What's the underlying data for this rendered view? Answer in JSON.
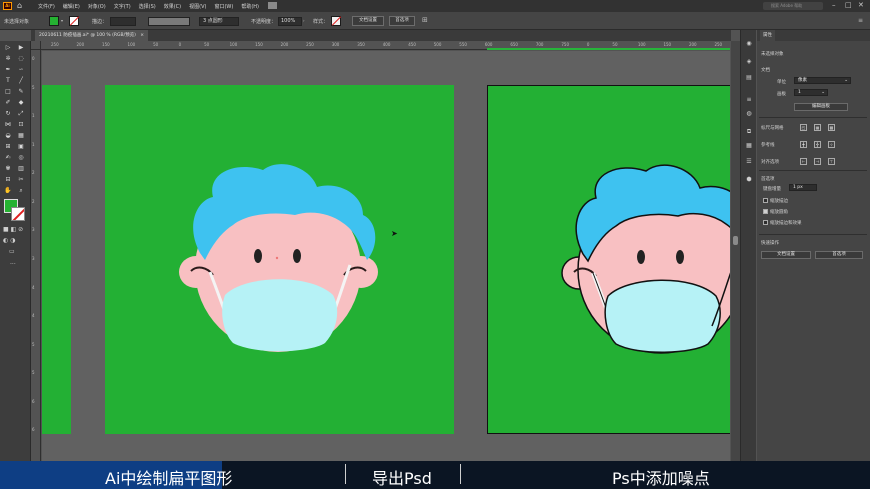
{
  "menubar": {
    "logo": "Ai",
    "menus": [
      "文件(F)",
      "编辑(E)",
      "对象(O)",
      "文字(T)",
      "选择(S)",
      "效果(C)",
      "视图(V)",
      "窗口(W)",
      "帮助(H)"
    ],
    "search_placeholder": "搜索 Adobe 帮助"
  },
  "controlbar": {
    "selection_label": "未选择对象",
    "stroke_label": "描边：",
    "stroke_value": "",
    "brush_label": "3 点圆形",
    "opacity_label": "不透明度：",
    "opacity_value": "100%",
    "style_label": "样式：",
    "doc_setup": "文档设置",
    "preferences": "首选项"
  },
  "document_tab": {
    "title": "20210611 防疫插画.ai* @ 100 % (RGB/预览)"
  },
  "ruler": {
    "top_ticks": [
      "250",
      "200",
      "150",
      "100",
      "50",
      "0",
      "50",
      "100",
      "150",
      "200",
      "250",
      "300",
      "350",
      "400",
      "450",
      "500",
      "550",
      "600",
      "650",
      "700",
      "750",
      "0",
      "50",
      "100",
      "150",
      "200",
      "250"
    ],
    "left_ticks": [
      "0",
      "5",
      "1",
      "1",
      "2",
      "2",
      "3",
      "3",
      "4",
      "4",
      "5",
      "5",
      "6",
      "6"
    ]
  },
  "properties": {
    "tab": "属性",
    "selection": "未选择对象",
    "doc_section": "文档",
    "unit_label": "单位",
    "unit_value": "像素",
    "artboard_label": "画板",
    "artboard_value": "1",
    "edit_artboards": "编辑画板",
    "snap_label": "标尺与网格",
    "guides_label": "参考线",
    "align_label": "对齐选项",
    "prefs_section": "首选项",
    "keyboard_inc_label": "键盘增量",
    "keyboard_inc_value": "1 px",
    "cb_scale_strokes": "缩放描边",
    "cb_scale_corners": "缩放圆角",
    "cb_scale_effects": "缩放描边和效果",
    "quick_actions": "快速操作",
    "doc_setup_btn": "文档设置",
    "prefs_btn": "首选项"
  },
  "caption": {
    "part1": "Ai中绘制扁平图形",
    "part2": "导出Psd",
    "part3": "Ps中添加噪点"
  },
  "colors": {
    "artboard_green": "#23b034",
    "hair_blue": "#3ec2f0",
    "skin_pink": "#f8c0c2",
    "mask_cyan": "#b6f2f6",
    "caption_highlight": "#0e3e84"
  }
}
